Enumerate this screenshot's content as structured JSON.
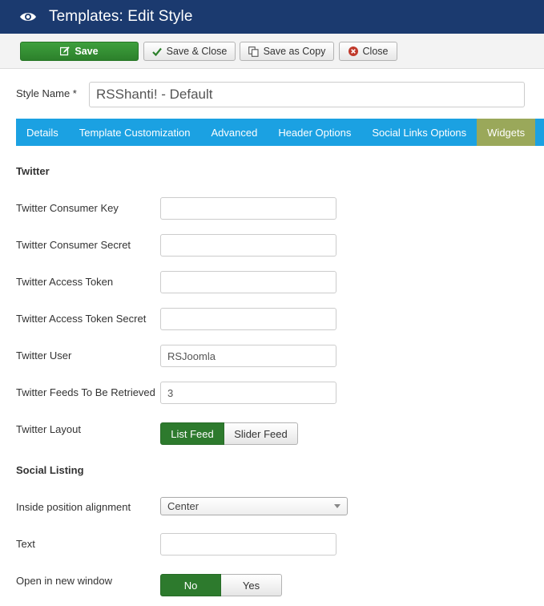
{
  "header": {
    "title": "Templates: Edit Style",
    "icon": "eye-icon"
  },
  "toolbar": {
    "save_label": "Save",
    "save_close_label": "Save & Close",
    "save_copy_label": "Save as Copy",
    "close_label": "Close"
  },
  "style_name": {
    "label": "Style Name *",
    "value": "RSShanti! - Default"
  },
  "tabs": [
    {
      "label": "Details"
    },
    {
      "label": "Template Customization"
    },
    {
      "label": "Advanced"
    },
    {
      "label": "Header Options"
    },
    {
      "label": "Social Links Options"
    },
    {
      "label": "Widgets",
      "active": true
    }
  ],
  "twitter": {
    "section_title": "Twitter",
    "consumer_key": {
      "label": "Twitter Consumer Key",
      "value": ""
    },
    "consumer_secret": {
      "label": "Twitter Consumer Secret",
      "value": ""
    },
    "access_token": {
      "label": "Twitter Access Token",
      "value": ""
    },
    "access_token_secret": {
      "label": "Twitter Access Token Secret",
      "value": ""
    },
    "user": {
      "label": "Twitter User",
      "value": "RSJoomla"
    },
    "feeds": {
      "label": "Twitter Feeds To Be Retrieved",
      "value": "3"
    },
    "layout": {
      "label": "Twitter Layout",
      "options": [
        "List Feed",
        "Slider Feed"
      ],
      "selected": "List Feed"
    }
  },
  "social_listing": {
    "section_title": "Social Listing",
    "alignment": {
      "label": "Inside position alignment",
      "value": "Center"
    },
    "text": {
      "label": "Text",
      "value": ""
    },
    "new_window": {
      "label": "Open in new window",
      "options": [
        "No",
        "Yes"
      ],
      "selected": "No"
    }
  },
  "colors": {
    "header_bg": "#1b3a6f",
    "tab_bar": "#1ba1e2",
    "tab_active": "#9aa85a",
    "save_green": "#2c802b",
    "toggle_on": "#2d7a2d"
  }
}
